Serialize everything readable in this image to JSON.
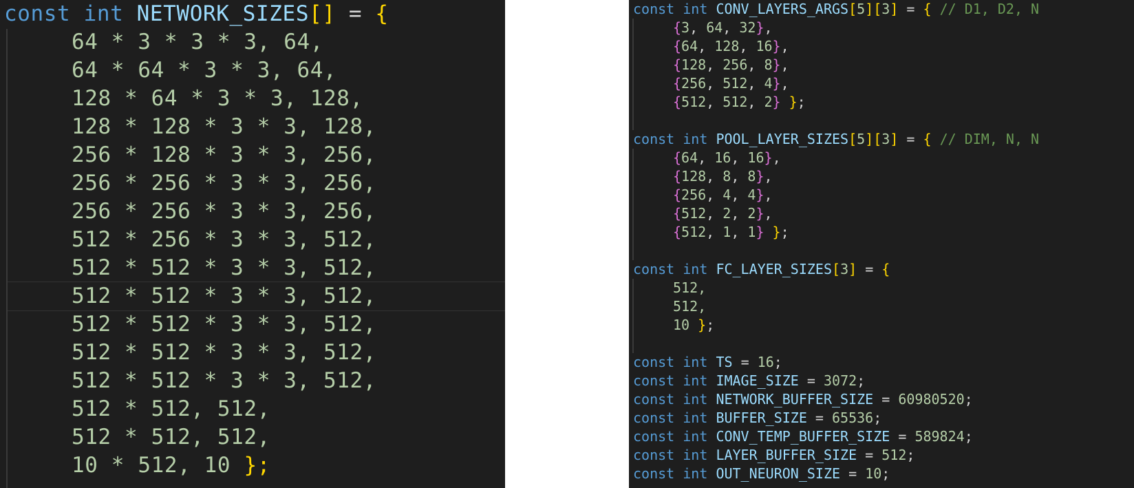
{
  "left_panel": {
    "declaration": {
      "keyword_const": "const",
      "keyword_type": "int",
      "name": "NETWORK_SIZES",
      "open": "[]",
      "assign": " = ",
      "brace": "{"
    },
    "rows": [
      "64 * 3 * 3 * 3, 64,",
      "64 * 64 * 3 * 3, 64,",
      "128 * 64 * 3 * 3, 128,",
      "128 * 128 * 3 * 3, 128,",
      "256 * 128 * 3 * 3, 256,",
      "256 * 256 * 3 * 3, 256,",
      "256 * 256 * 3 * 3, 256,",
      "512 * 256 * 3 * 3, 512,",
      "512 * 512 * 3 * 3, 512,",
      "512 * 512 * 3 * 3, 512,",
      "512 * 512 * 3 * 3, 512,",
      "512 * 512 * 3 * 3, 512,",
      "512 * 512 * 3 * 3, 512,",
      "512 * 512, 512,",
      "512 * 512, 512,",
      "10 * 512, 10"
    ],
    "closing": "};"
  },
  "right_panel": {
    "conv": {
      "decl": {
        "c": "const",
        "t": "int",
        "name": "CONV_LAYERS_ARGS",
        "dims": [
          "5",
          "3"
        ],
        "comment": "// D1, D2, N"
      },
      "rows": [
        [
          "3",
          "64",
          "32"
        ],
        [
          "64",
          "128",
          "16"
        ],
        [
          "128",
          "256",
          "8"
        ],
        [
          "256",
          "512",
          "4"
        ],
        [
          "512",
          "512",
          "2"
        ]
      ]
    },
    "pool": {
      "decl": {
        "c": "const",
        "t": "int",
        "name": "POOL_LAYER_SIZES",
        "dims": [
          "5",
          "3"
        ],
        "comment": "// DIM, N, N"
      },
      "rows": [
        [
          "64",
          "16",
          "16"
        ],
        [
          "128",
          "8",
          "8"
        ],
        [
          "256",
          "4",
          "4"
        ],
        [
          "512",
          "2",
          "2"
        ],
        [
          "512",
          "1",
          "1"
        ]
      ]
    },
    "fc": {
      "decl": {
        "c": "const",
        "t": "int",
        "name": "FC_LAYER_SIZES",
        "dims": [
          "3"
        ]
      },
      "rows": [
        "512,",
        "512,",
        "10"
      ]
    },
    "constants": [
      {
        "name": "TS",
        "value": "16"
      },
      {
        "name": "IMAGE_SIZE",
        "value": "3072"
      },
      {
        "name": "NETWORK_BUFFER_SIZE",
        "value": "60980520"
      },
      {
        "name": "BUFFER_SIZE",
        "value": "65536"
      },
      {
        "name": "CONV_TEMP_BUFFER_SIZE",
        "value": "589824"
      },
      {
        "name": "LAYER_BUFFER_SIZE",
        "value": "512"
      },
      {
        "name": "OUT_NEURON_SIZE",
        "value": "10"
      }
    ]
  }
}
